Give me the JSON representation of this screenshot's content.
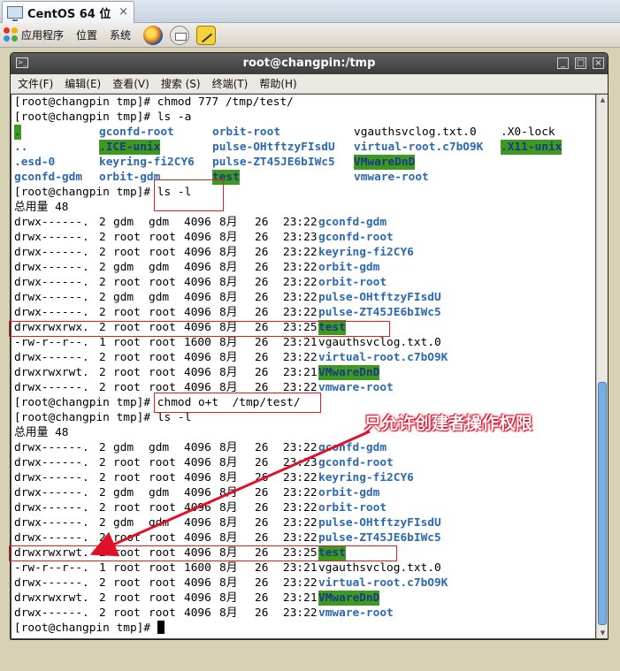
{
  "vm_tab": {
    "title": "CentOS 64 位",
    "close": "×"
  },
  "panel": {
    "menus": [
      "应用程序",
      "位置",
      "系统"
    ]
  },
  "window": {
    "title": "root@changpin:/tmp",
    "buttons": [
      "_",
      "□",
      "×"
    ],
    "menu": [
      "文件(F)",
      "编辑(E)",
      "查看(V)",
      "搜索 (S)",
      "终端(T)",
      "帮助(H)"
    ]
  },
  "terminal": {
    "prompt": "[root@changpin tmp]# ",
    "cmd_chmod777": "chmod 777 /tmp/test/",
    "cmd_lsa": "ls -a",
    "cmd_lsl": "ls -l",
    "cmd_chmod_ot": "chmod o+t  /tmp/test/",
    "total": "总用量 48",
    "lsa": {
      "col1": [
        ".",
        "..",
        ".esd-0",
        "gconfd-gdm"
      ],
      "col2": [
        "gconfd-root",
        ".ICE-unix",
        "keyring-fi2CY6",
        "orbit-gdm"
      ],
      "col3": [
        "orbit-root",
        "pulse-OHtftzyFIsdU",
        "pulse-ZT45JE6bIWc5",
        "test"
      ],
      "col4": [
        "vgauthsvclog.txt.0",
        "virtual-root.c7bO9K",
        "VMwareDnD",
        "vmware-root"
      ],
      "col5": [
        ".X0-lock",
        ".X11-unix"
      ]
    },
    "listing1": [
      {
        "perm": "drwx------.",
        "n": "2",
        "user": "gdm",
        "group": "gdm",
        "size": "4096",
        "month": "8月",
        "day": "26",
        "time": "23:22",
        "name": "gconfd-gdm"
      },
      {
        "perm": "drwx------.",
        "n": "2",
        "user": "root",
        "group": "root",
        "size": "4096",
        "month": "8月",
        "day": "26",
        "time": "23:23",
        "name": "gconfd-root"
      },
      {
        "perm": "drwx------.",
        "n": "2",
        "user": "root",
        "group": "root",
        "size": "4096",
        "month": "8月",
        "day": "26",
        "time": "23:22",
        "name": "keyring-fi2CY6"
      },
      {
        "perm": "drwx------.",
        "n": "2",
        "user": "gdm",
        "group": "gdm",
        "size": "4096",
        "month": "8月",
        "day": "26",
        "time": "23:22",
        "name": "orbit-gdm"
      },
      {
        "perm": "drwx------.",
        "n": "2",
        "user": "root",
        "group": "root",
        "size": "4096",
        "month": "8月",
        "day": "26",
        "time": "23:22",
        "name": "orbit-root"
      },
      {
        "perm": "drwx------.",
        "n": "2",
        "user": "gdm",
        "group": "gdm",
        "size": "4096",
        "month": "8月",
        "day": "26",
        "time": "23:22",
        "name": "pulse-OHtftzyFIsdU"
      },
      {
        "perm": "drwx------.",
        "n": "2",
        "user": "root",
        "group": "root",
        "size": "4096",
        "month": "8月",
        "day": "26",
        "time": "23:22",
        "name": "pulse-ZT45JE6bIWc5"
      },
      {
        "perm": "drwxrwxrwx.",
        "n": "2",
        "user": "root",
        "group": "root",
        "size": "4096",
        "month": "8月",
        "day": "26",
        "time": "23:25",
        "name": "test"
      },
      {
        "perm": "-rw-r--r--.",
        "n": "1",
        "user": "root",
        "group": "root",
        "size": "1600",
        "month": "8月",
        "day": "26",
        "time": "23:21",
        "name": "vgauthsvclog.txt.0"
      },
      {
        "perm": "drwx------.",
        "n": "2",
        "user": "root",
        "group": "root",
        "size": "4096",
        "month": "8月",
        "day": "26",
        "time": "23:22",
        "name": "virtual-root.c7bO9K"
      },
      {
        "perm": "drwxrwxrwt.",
        "n": "2",
        "user": "root",
        "group": "root",
        "size": "4096",
        "month": "8月",
        "day": "26",
        "time": "23:21",
        "name": "VMwareDnD"
      },
      {
        "perm": "drwx------.",
        "n": "2",
        "user": "root",
        "group": "root",
        "size": "4096",
        "month": "8月",
        "day": "26",
        "time": "23:22",
        "name": "vmware-root"
      }
    ],
    "listing2": [
      {
        "perm": "drwx------.",
        "n": "2",
        "user": "gdm",
        "group": "gdm",
        "size": "4096",
        "month": "8月",
        "day": "26",
        "time": "23:22",
        "name": "gconfd-gdm"
      },
      {
        "perm": "drwx------.",
        "n": "2",
        "user": "root",
        "group": "root",
        "size": "4096",
        "month": "8月",
        "day": "26",
        "time": "23:23",
        "name": "gconfd-root"
      },
      {
        "perm": "drwx------.",
        "n": "2",
        "user": "root",
        "group": "root",
        "size": "4096",
        "month": "8月",
        "day": "26",
        "time": "23:22",
        "name": "keyring-fi2CY6"
      },
      {
        "perm": "drwx------.",
        "n": "2",
        "user": "gdm",
        "group": "gdm",
        "size": "4096",
        "month": "8月",
        "day": "26",
        "time": "23:22",
        "name": "orbit-gdm"
      },
      {
        "perm": "drwx------.",
        "n": "2",
        "user": "root",
        "group": "root",
        "size": "4096",
        "month": "8月",
        "day": "26",
        "time": "23:22",
        "name": "orbit-root"
      },
      {
        "perm": "drwx------.",
        "n": "2",
        "user": "gdm",
        "group": "gdm",
        "size": "4096",
        "month": "8月",
        "day": "26",
        "time": "23:22",
        "name": "pulse-OHtftzyFIsdU"
      },
      {
        "perm": "drwx------.",
        "n": "2",
        "user": "root",
        "group": "root",
        "size": "4096",
        "month": "8月",
        "day": "26",
        "time": "23:22",
        "name": "pulse-ZT45JE6bIWc5"
      },
      {
        "perm": "drwxrwxrwt.",
        "n": "2",
        "user": "root",
        "group": "root",
        "size": "4096",
        "month": "8月",
        "day": "26",
        "time": "23:25",
        "name": "test"
      },
      {
        "perm": "-rw-r--r--.",
        "n": "1",
        "user": "root",
        "group": "root",
        "size": "1600",
        "month": "8月",
        "day": "26",
        "time": "23:21",
        "name": "vgauthsvclog.txt.0"
      },
      {
        "perm": "drwx------.",
        "n": "2",
        "user": "root",
        "group": "root",
        "size": "4096",
        "month": "8月",
        "day": "26",
        "time": "23:22",
        "name": "virtual-root.c7bO9K"
      },
      {
        "perm": "drwxrwxrwt.",
        "n": "2",
        "user": "root",
        "group": "root",
        "size": "4096",
        "month": "8月",
        "day": "26",
        "time": "23:21",
        "name": "VMwareDnD"
      },
      {
        "perm": "drwx------.",
        "n": "2",
        "user": "root",
        "group": "root",
        "size": "4096",
        "month": "8月",
        "day": "26",
        "time": "23:22",
        "name": "vmware-root"
      }
    ]
  },
  "annotation": {
    "text": "只允许创建者操作权限",
    "color": "#e0102a"
  },
  "colors": {
    "dir": "#2b69b0",
    "highlight": "#3d9a1e",
    "annotation": "#e02020"
  }
}
